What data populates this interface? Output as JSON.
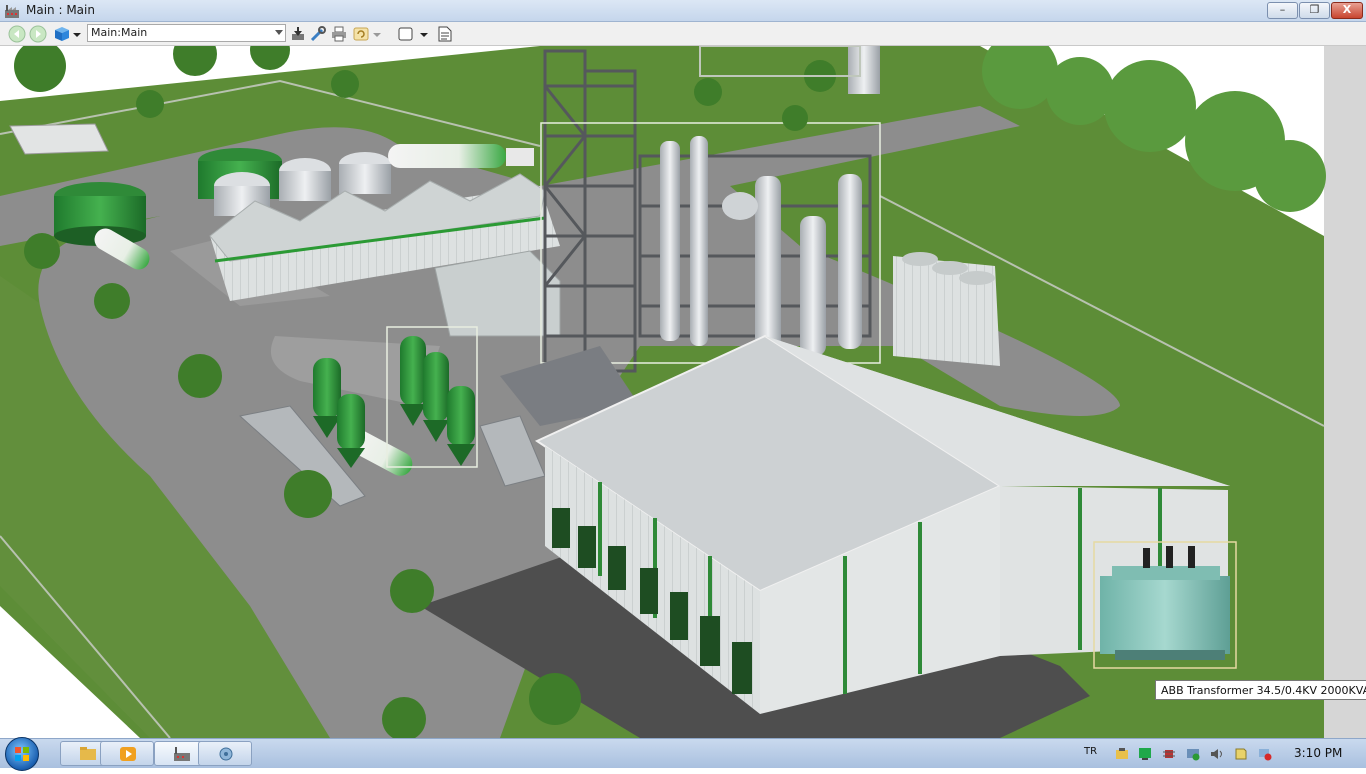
{
  "window": {
    "title": "Main : Main",
    "minimize_symbol": "–",
    "restore_symbol": "❐",
    "close_symbol": "X"
  },
  "toolbar": {
    "address_value": "Main:Main",
    "icons": [
      "back-icon",
      "forward-icon",
      "cube-icon",
      "save-icon",
      "tools-icon",
      "print-icon",
      "refresh-icon",
      "window-icon",
      "document-icon"
    ]
  },
  "scene": {
    "tooltip": "ABB Transformer 34.5/0.4KV 2000KVA"
  },
  "taskbar": {
    "language": "TR",
    "clock": "3:10 PM",
    "apps": [
      "explorer-icon",
      "media-player-icon",
      "factory-app-icon",
      "network-app-icon"
    ]
  },
  "colors": {
    "grass": "#5e8f3a",
    "road": "#8c8c8c",
    "accent_green": "#2e9a3a",
    "building_white": "#e9ecec",
    "steel": "#6d7075"
  }
}
